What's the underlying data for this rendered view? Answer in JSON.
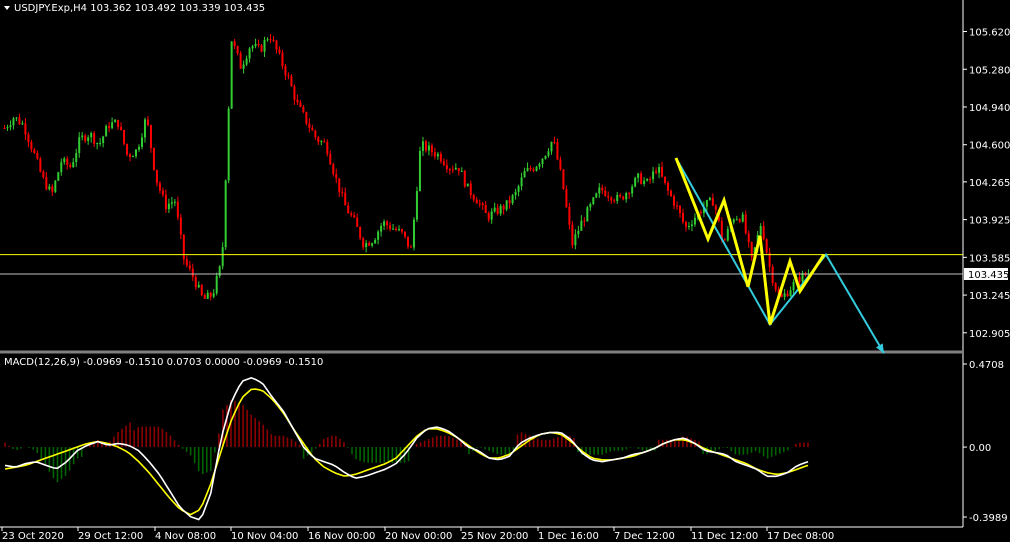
{
  "header": {
    "symbol_line": "USDJPY.Exp,H4  103.362 103.492 103.339 103.435",
    "dropdown_icon": "triangle-down-icon"
  },
  "macd": {
    "label": "MACD(12,26,9) -0.0969 -0.1510 0.0703 0.0000 -0.0969 -0.1510"
  },
  "price_axis": {
    "ticks": [
      "105.620",
      "105.280",
      "104.940",
      "104.600",
      "104.265",
      "103.925",
      "103.585",
      "103.245",
      "102.905"
    ],
    "current_price": "103.435"
  },
  "macd_axis": {
    "ticks": [
      "0.4708",
      "0.00",
      "-0.3989"
    ]
  },
  "time_axis": {
    "ticks": [
      "23 Oct 2020",
      "29 Oct 12:00",
      "4 Nov 08:00",
      "10 Nov 04:00",
      "16 Nov 00:00",
      "20 Nov 00:00",
      "25 Nov 20:00",
      "1 Dec 16:00",
      "7 Dec 12:00",
      "11 Dec 12:00",
      "17 Dec 08:00"
    ]
  },
  "colors": {
    "background": "#000000",
    "bull": "#32cd32",
    "bear": "#ff0000",
    "macd_line": "#ffffff",
    "signal_line": "#ffff00",
    "hist_pos": "#8b0000",
    "hist_neg": "#006400",
    "support_line": "#ffff00",
    "price_line": "#c0c0c0",
    "pattern_yellow": "#ffff00",
    "pattern_cyan": "#33ccdd"
  },
  "chart_data": {
    "type": "candlestick",
    "price_range": [
      102.75,
      105.85
    ],
    "macd_range": [
      -0.3989,
      0.4708
    ],
    "support_level": 103.61,
    "current_price": 103.435,
    "price_path": [
      104.75,
      104.85,
      104.78,
      104.55,
      104.3,
      104.15,
      104.45,
      104.4,
      104.65,
      104.7,
      104.6,
      104.78,
      104.8,
      104.5,
      104.55,
      104.85,
      104.3,
      104.05,
      104.1,
      103.55,
      103.4,
      103.2,
      103.25,
      103.55,
      105.55,
      105.3,
      105.5,
      105.45,
      105.6,
      105.4,
      105.2,
      104.95,
      104.8,
      104.65,
      104.6,
      104.3,
      104.05,
      103.9,
      103.7,
      103.75,
      103.9,
      103.85,
      103.8,
      103.65,
      104.6,
      104.55,
      104.5,
      104.4,
      104.4,
      104.2,
      104.1,
      103.95,
      104.0,
      104.05,
      104.15,
      104.35,
      104.4,
      104.5,
      104.65,
      104.25,
      103.7,
      103.9,
      104.05,
      104.2,
      104.15,
      104.1,
      104.2,
      104.3,
      104.25,
      104.4,
      104.2,
      104.05,
      103.85,
      103.95,
      104.05,
      104.1,
      103.7,
      103.95,
      103.95,
      103.55,
      103.9,
      103.45,
      103.2,
      103.3,
      103.4,
      103.44
    ],
    "macd_path": [
      -0.1,
      -0.11,
      -0.09,
      -0.08,
      -0.1,
      -0.12,
      -0.08,
      -0.02,
      0.01,
      0.03,
      0.01,
      0.02,
      0.01,
      -0.02,
      -0.08,
      -0.15,
      -0.24,
      -0.33,
      -0.38,
      -0.4,
      -0.25,
      0.05,
      0.25,
      0.36,
      0.38,
      0.35,
      0.27,
      0.2,
      0.1,
      0.0,
      -0.06,
      -0.08,
      -0.1,
      -0.14,
      -0.17,
      -0.16,
      -0.14,
      -0.12,
      -0.09,
      -0.03,
      0.05,
      0.1,
      0.11,
      0.09,
      0.05,
      0.0,
      -0.02,
      -0.06,
      -0.07,
      -0.05,
      0.02,
      0.05,
      0.07,
      0.08,
      0.08,
      0.04,
      -0.03,
      -0.07,
      -0.08,
      -0.07,
      -0.06,
      -0.04,
      -0.03,
      -0.01,
      0.02,
      0.04,
      0.05,
      0.02,
      -0.02,
      -0.03,
      -0.04,
      -0.08,
      -0.1,
      -0.12,
      -0.16,
      -0.16,
      -0.14,
      -0.1,
      -0.08
    ],
    "signal_path": [
      -0.12,
      -0.11,
      -0.1,
      -0.08,
      -0.06,
      -0.04,
      -0.02,
      0.0,
      0.02,
      0.03,
      0.02,
      0.0,
      -0.03,
      -0.08,
      -0.14,
      -0.21,
      -0.28,
      -0.34,
      -0.37,
      -0.34,
      -0.2,
      -0.02,
      0.15,
      0.27,
      0.32,
      0.31,
      0.26,
      0.19,
      0.1,
      0.02,
      -0.06,
      -0.11,
      -0.14,
      -0.16,
      -0.15,
      -0.13,
      -0.11,
      -0.09,
      -0.06,
      0.0,
      0.06,
      0.1,
      0.1,
      0.08,
      0.05,
      0.01,
      -0.03,
      -0.06,
      -0.06,
      -0.04,
      0.0,
      0.04,
      0.07,
      0.08,
      0.07,
      0.03,
      -0.02,
      -0.06,
      -0.07,
      -0.07,
      -0.06,
      -0.05,
      -0.03,
      -0.01,
      0.02,
      0.04,
      0.04,
      0.02,
      -0.01,
      -0.03,
      -0.05,
      -0.07,
      -0.09,
      -0.12,
      -0.14,
      -0.15,
      -0.14,
      -0.12,
      -0.1
    ],
    "pattern_yellow": [
      [
        103.93,
        104.25
      ],
      [
        103.58,
        103.78
      ],
      [
        104.05,
        104.6
      ],
      [
        103.3,
        103.55
      ],
      [
        103.75,
        103.5
      ],
      [
        103.05,
        103.25
      ],
      [
        103.55,
        103.6
      ]
    ],
    "pattern_cyan": [
      [
        104.48,
        103.3
      ],
      [
        102.95,
        103.61
      ],
      [
        102.72
      ]
    ]
  }
}
